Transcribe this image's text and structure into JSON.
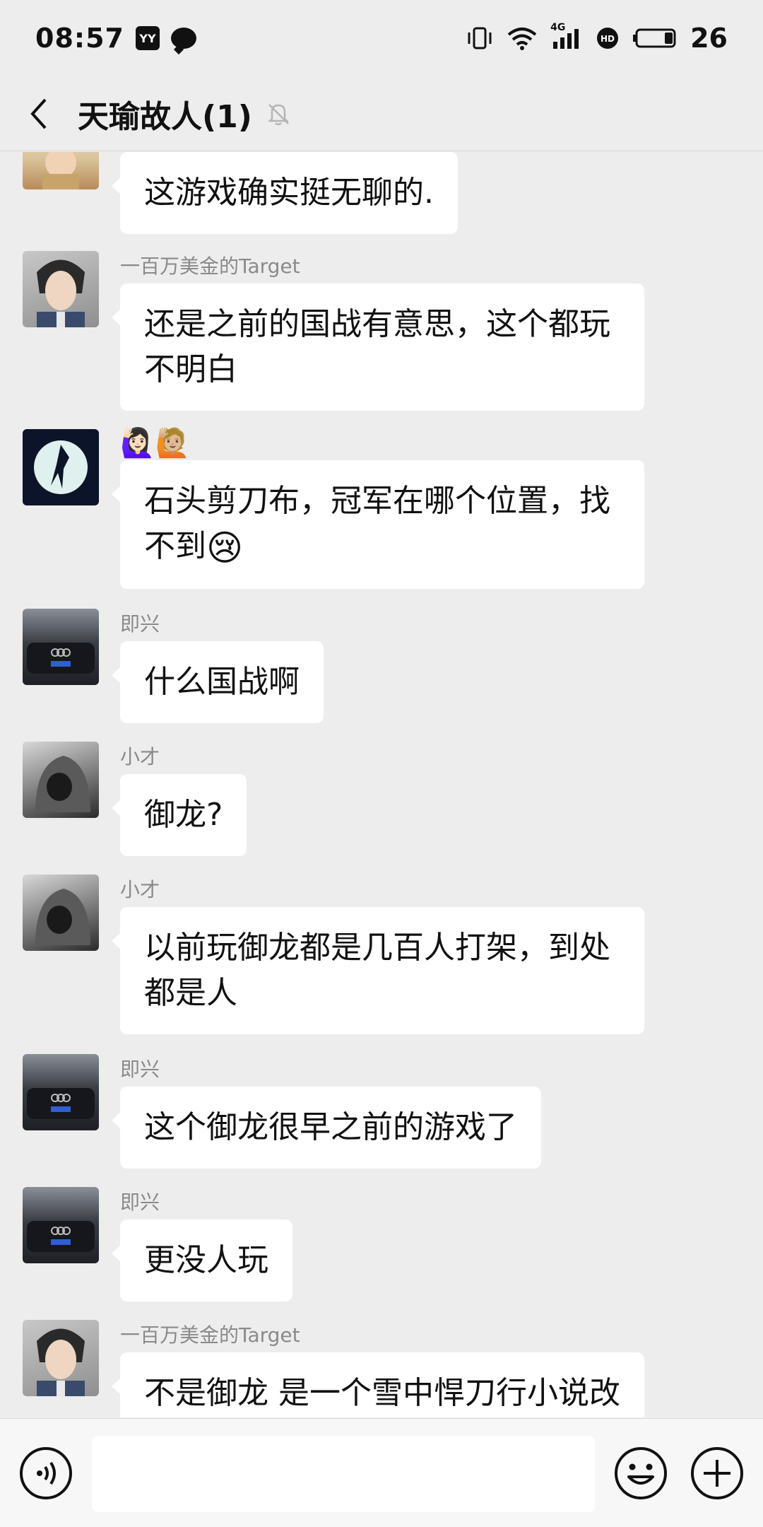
{
  "status_bar": {
    "time": "08:57",
    "app_icon_text": "YY",
    "network": "4G",
    "battery": "26",
    "icons": [
      "yy-app-icon",
      "chat-bubble-icon",
      "vibrate-icon",
      "wifi-icon",
      "signal-icon",
      "hd-icon",
      "battery-icon"
    ]
  },
  "header": {
    "title": "天瑜故人(1)",
    "icons": [
      "back-arrow-icon",
      "mute-bell-icon"
    ]
  },
  "messages": [
    {
      "sender": "",
      "text": "这游戏确实挺无聊的.",
      "avatar": "kid-photo"
    },
    {
      "sender": "一百万美金的Target",
      "text_lines": [
        "还是之前的国战有意思，这个都玩",
        "不明白"
      ],
      "avatar": "anime-character"
    },
    {
      "sender": "🙋🏻‍♀️🙋🏼",
      "text_lines": [
        "石头剪刀布，冠军在哪个位置，找",
        "不到"
      ],
      "trailing_emoji": "😢",
      "avatar": "moon-silhouette"
    },
    {
      "sender": "即兴",
      "text": "什么国战啊",
      "avatar": "black-car"
    },
    {
      "sender": "小才",
      "text": "御龙?",
      "avatar": "hooded-figure"
    },
    {
      "sender": "小才",
      "text_lines": [
        "以前玩御龙都是几百人打架，到处",
        "都是人"
      ],
      "avatar": "hooded-figure"
    },
    {
      "sender": "即兴",
      "text": "这个御龙很早之前的游戏了",
      "avatar": "black-car"
    },
    {
      "sender": "即兴",
      "text": "更没人玩",
      "avatar": "black-car"
    },
    {
      "sender": "一百万美金的Target",
      "text": "不是御龙 是一个雪中悍刀行小说改",
      "avatar": "anime-character"
    }
  ],
  "input_bar": {
    "placeholder": "",
    "icons": [
      "voice-icon",
      "emoji-icon",
      "plus-icon"
    ]
  }
}
